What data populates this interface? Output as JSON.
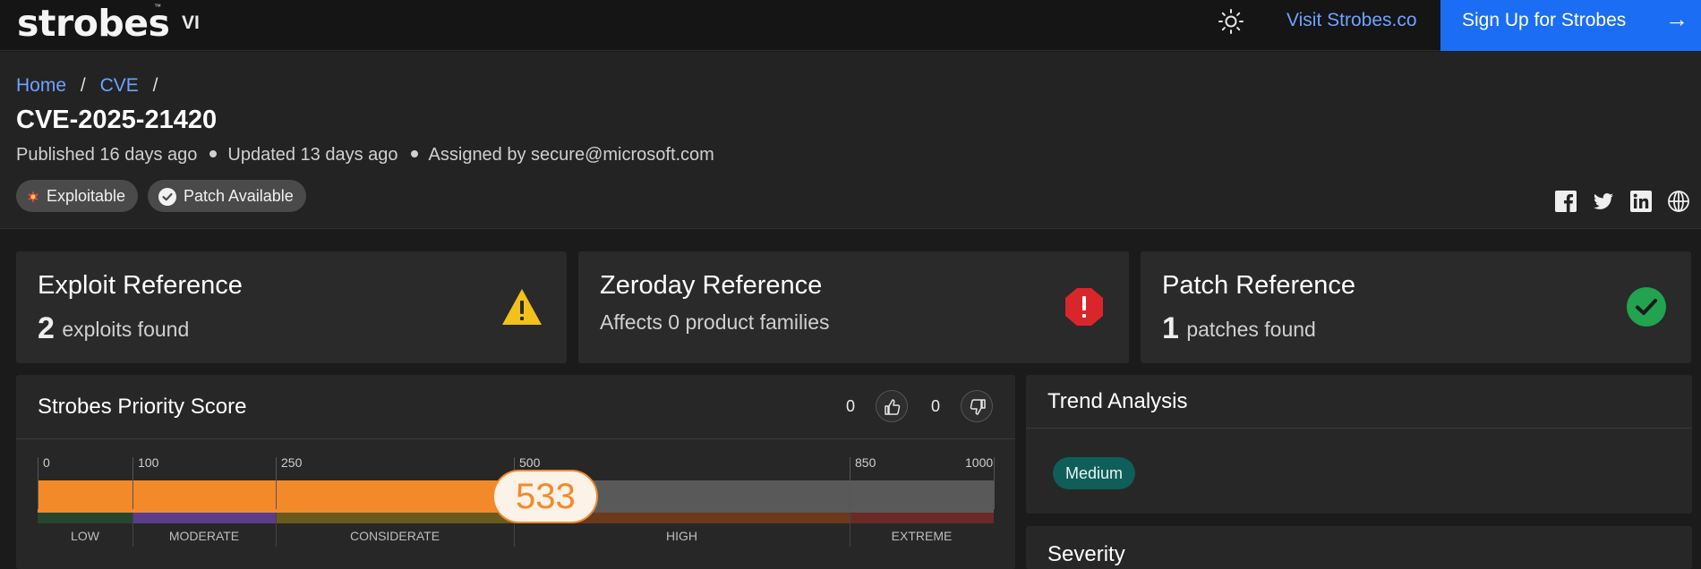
{
  "topbar": {
    "logo": "strobes",
    "logo_tm": "™",
    "logo_suffix": "VI",
    "theme_icon": "sun-icon",
    "visit_link": "Visit Strobes.co",
    "signup_label": "Sign Up for Strobes",
    "signup_arrow": "→",
    "signup_color": "#1b6ef3"
  },
  "breadcrumb": {
    "items": [
      "Home",
      "CVE"
    ],
    "separator": "/"
  },
  "cve": {
    "id": "CVE-2025-21420",
    "published": "Published 16 days ago",
    "updated": "Updated 13 days ago",
    "assigned": "Assigned by secure@microsoft.com",
    "tags": [
      {
        "label": "Exploitable",
        "icon": "exploit-burst-icon"
      },
      {
        "label": "Patch Available",
        "icon": "check-circle-icon"
      }
    ]
  },
  "social": [
    "facebook-icon",
    "twitter-icon",
    "linkedin-icon",
    "globe-icon"
  ],
  "cards": [
    {
      "title": "Exploit Reference",
      "count": "2",
      "text": "exploits found",
      "icon": "warning-triangle-icon",
      "icon_color": "#f2c21b"
    },
    {
      "title": "Zeroday Reference",
      "count": "",
      "text": "Affects 0 product families",
      "icon": "alert-octagon-icon",
      "icon_color": "#d9262b"
    },
    {
      "title": "Patch Reference",
      "count": "1",
      "text": "patches found",
      "icon": "check-circle-icon",
      "icon_color": "#21a34f"
    }
  ],
  "priority": {
    "title": "Strobes Priority Score",
    "upvotes": "0",
    "downvotes": "0",
    "score": "533",
    "score_value": 533,
    "scale_max": 1000,
    "ticks": [
      "0",
      "100",
      "250",
      "500",
      "850",
      "1000"
    ],
    "segments": [
      "LOW",
      "MODERATE",
      "CONSIDERATE",
      "HIGH",
      "EXTREME"
    ],
    "accent": "#f28a2a"
  },
  "trend": {
    "title": "Trend Analysis",
    "level": "Medium"
  },
  "severity": {
    "title": "Severity"
  }
}
